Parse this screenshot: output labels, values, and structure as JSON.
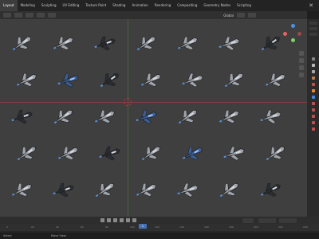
{
  "topbar": {
    "tabs": [
      "Layout",
      "Modeling",
      "Sculpting",
      "UV Editing",
      "Texture Paint",
      "Shading",
      "Animation",
      "Rendering",
      "Compositing",
      "Geometry Nodes",
      "Scripting"
    ],
    "active_tab": 0
  },
  "header": {
    "mode_label": "Global"
  },
  "timeline": {
    "current_frame": "1",
    "ruler_ticks": [
      "0",
      "20",
      "40",
      "60",
      "80",
      "100",
      "120",
      "140",
      "160",
      "180",
      "200",
      "220",
      "240"
    ]
  },
  "status_bar": {
    "left_text": "Select",
    "right_text": "Move View"
  },
  "ships": [
    {
      "variant": "light"
    },
    {
      "variant": "light"
    },
    {
      "variant": "dark"
    },
    {
      "variant": "light"
    },
    {
      "variant": "light"
    },
    {
      "variant": "light"
    },
    {
      "variant": "dark"
    },
    {
      "variant": "light"
    },
    {
      "variant": "blue"
    },
    {
      "variant": "dark"
    },
    {
      "variant": "light"
    },
    {
      "variant": "light"
    },
    {
      "variant": "light"
    },
    {
      "variant": "light"
    },
    {
      "variant": "dark"
    },
    {
      "variant": "light"
    },
    {
      "variant": "light"
    },
    {
      "variant": "blue"
    },
    {
      "variant": "light"
    },
    {
      "variant": "light"
    },
    {
      "variant": "light"
    },
    {
      "variant": "light"
    },
    {
      "variant": "light"
    },
    {
      "variant": "dark"
    },
    {
      "variant": "light"
    },
    {
      "variant": "blue"
    },
    {
      "variant": "light"
    },
    {
      "variant": "light"
    },
    {
      "variant": "light"
    },
    {
      "variant": "dark"
    },
    {
      "variant": "light"
    },
    {
      "variant": "light"
    },
    {
      "variant": "light"
    },
    {
      "variant": "light"
    },
    {
      "variant": "dark"
    }
  ],
  "colors": {
    "x_axis": "#e06666",
    "y_axis": "#7fd16a",
    "z_axis": "#4f8fe6"
  }
}
